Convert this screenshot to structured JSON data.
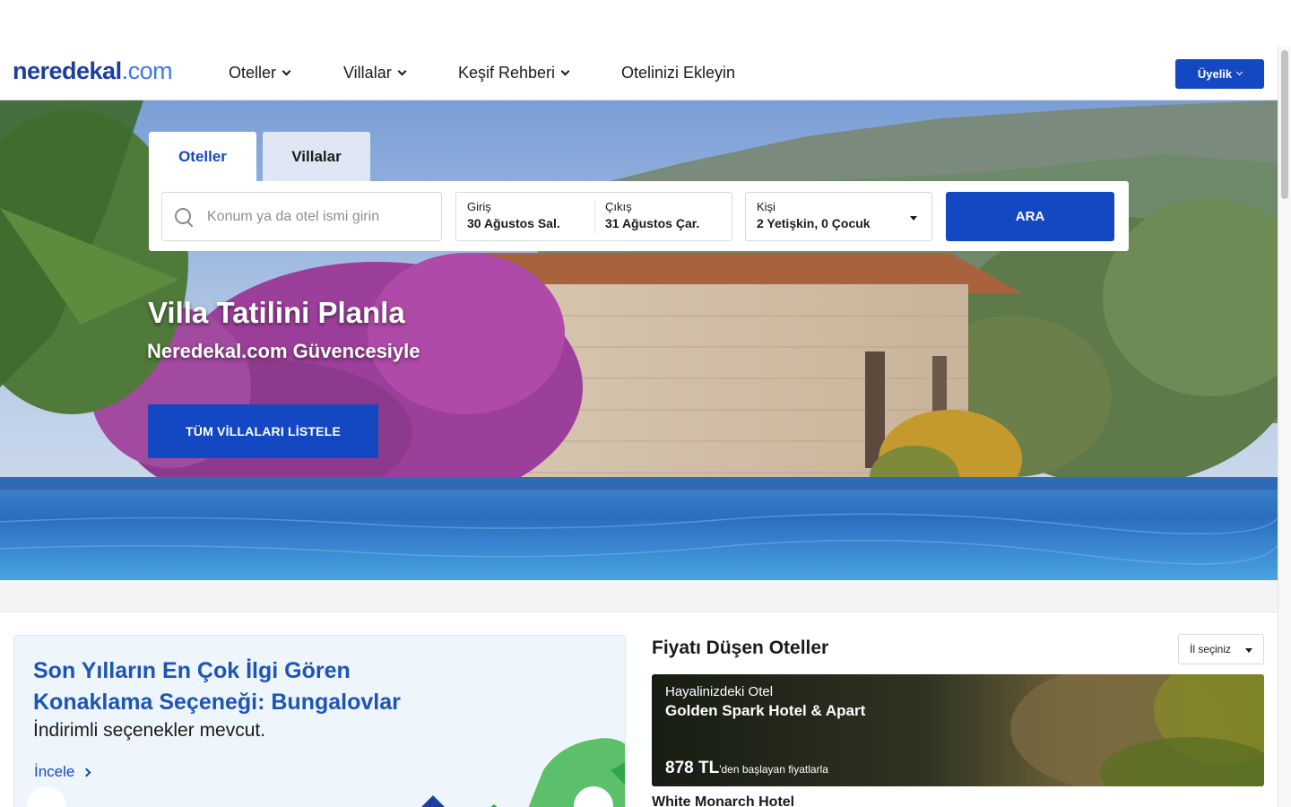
{
  "header": {
    "logo_main": "neredekal",
    "logo_suffix": ".com",
    "nav": [
      "Oteller",
      "Villalar",
      "Keşif Rehberi",
      "Otelinizi Ekleyin"
    ],
    "member_label": "Üyelik"
  },
  "search": {
    "tabs": [
      "Oteller",
      "Villalar"
    ],
    "active_tab": "Oteller",
    "location_placeholder": "Konum ya da otel ismi girin",
    "checkin_label": "Giriş",
    "checkin_value": "30 Ağustos Sal.",
    "checkout_label": "Çıkış",
    "checkout_value": "31 Ağustos Çar.",
    "guests_label": "Kişi",
    "guests_value": "2 Yetişkin, 0 Çocuk",
    "submit_label": "ARA"
  },
  "hero": {
    "title": "Villa Tatilini Planla",
    "subtitle": "Neredekal.com Güvencesiyle",
    "cta": "TÜM VİLLALARI LİSTELE"
  },
  "promo": {
    "title": "Son Yılların En Çok İlgi Gören Konaklama Seçeneği: Bungalovlar",
    "subtitle": "İndirimli seçenekler mevcut.",
    "link": "İncele"
  },
  "deals": {
    "title": "Fiyatı Düşen Oteller",
    "city_select": "İl seçiniz",
    "cards": [
      {
        "kicker": "Hayalinizdeki Otel",
        "name": "Golden Spark Hotel & Apart",
        "price": "878 TL",
        "price_suffix": "'den başlayan fiyatlarla"
      }
    ],
    "next_name": "White Monarch Hotel"
  },
  "colors": {
    "brand_blue": "#1448c2",
    "logo_dark": "#1b3f9e",
    "logo_light": "#3b7be0",
    "promo_title": "#1d55b6"
  }
}
